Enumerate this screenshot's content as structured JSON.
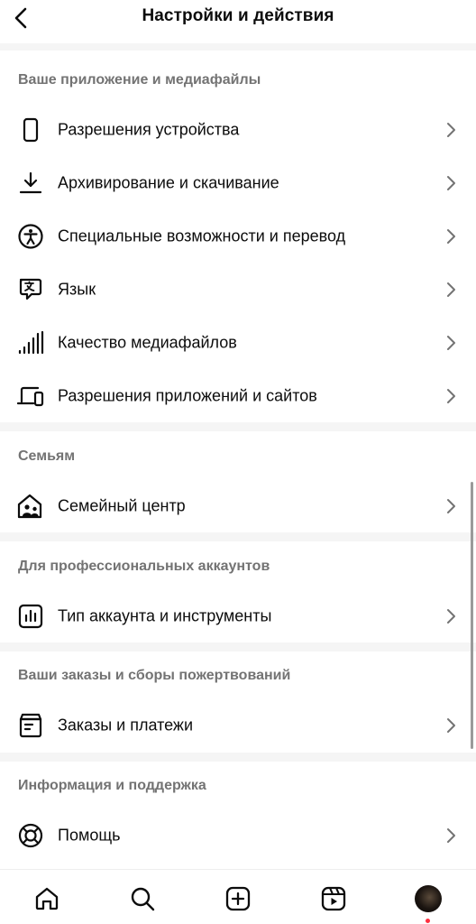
{
  "header": {
    "title": "Настройки и действия"
  },
  "sections": {
    "app_media": {
      "title": "Ваше приложение и медиафайлы",
      "items": [
        {
          "label": "Разрешения устройства",
          "icon": "phone-icon"
        },
        {
          "label": "Архивирование и скачивание",
          "icon": "download-icon"
        },
        {
          "label": "Специальные возможности и перевод",
          "icon": "accessibility-icon"
        },
        {
          "label": "Язык",
          "icon": "language-icon"
        },
        {
          "label": "Качество медиафайлов",
          "icon": "signal-bars-icon"
        },
        {
          "label": "Разрешения приложений и сайтов",
          "icon": "devices-icon"
        }
      ]
    },
    "family": {
      "title": "Семьям",
      "items": [
        {
          "label": "Семейный центр",
          "icon": "family-home-icon"
        }
      ]
    },
    "professional": {
      "title": "Для профессиональных аккаунтов",
      "items": [
        {
          "label": "Тип аккаунта и инструменты",
          "icon": "insights-icon"
        }
      ]
    },
    "orders": {
      "title": "Ваши заказы и сборы пожертвований",
      "items": [
        {
          "label": "Заказы и платежи",
          "icon": "orders-box-icon"
        }
      ]
    },
    "support": {
      "title": "Информация и поддержка",
      "items": [
        {
          "label": "Помощь",
          "icon": "lifebuoy-icon"
        }
      ]
    }
  },
  "bottom_nav": {
    "items": [
      {
        "icon": "home-icon"
      },
      {
        "icon": "search-icon"
      },
      {
        "icon": "create-icon"
      },
      {
        "icon": "reels-icon"
      },
      {
        "icon": "profile-avatar"
      }
    ],
    "notification_dot_color": "#ff3040"
  },
  "colors": {
    "text_primary": "#0c0c0c",
    "section_title": "#737373",
    "divider": "#f5f5f5"
  }
}
